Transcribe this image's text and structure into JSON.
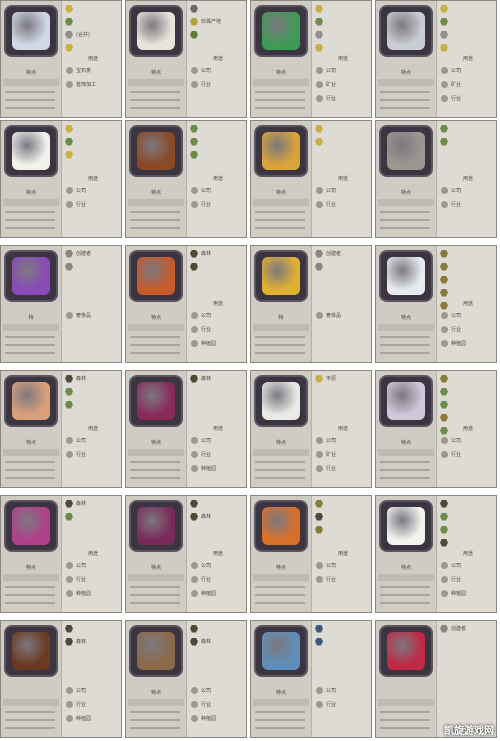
{
  "cards": [
    {
      "id": "diamond",
      "rows": [
        "",
        "",
        "(合并)",
        ""
      ],
      "section": "特点",
      "usage": "用途",
      "bottom": [
        "宝石类",
        "首饰加工"
      ],
      "icon_color": "#cfd8e6",
      "hex": [
        "#c9b043",
        "#6d8c4b",
        "#8f8f8f"
      ]
    },
    {
      "id": "pearl",
      "rows": [
        "",
        "珍珠产地",
        ""
      ],
      "section": "特点",
      "usage": "用途",
      "bottom": [
        "公司",
        "行业"
      ],
      "icon_color": "#e8e4da",
      "hex": [
        "#6a6a6a",
        "#b0a23e",
        "#5d7e3b"
      ]
    },
    {
      "id": "jade-dragon",
      "rows": [
        "",
        "",
        "",
        ""
      ],
      "section": "特点",
      "usage": "用途",
      "bottom": [
        "公司",
        "矿业",
        "行业"
      ],
      "icon_color": "#3f9a55",
      "hex": [
        "#c9b043",
        "#6d8c4b",
        "#8f8f8f"
      ]
    },
    {
      "id": "silver-pitcher",
      "rows": [
        "",
        "",
        "",
        ""
      ],
      "section": "特点",
      "usage": "用途",
      "bottom": [
        "公司",
        "矿业",
        "行业"
      ],
      "icon_color": "#c9ccd2",
      "hex": [
        "#c9b043",
        "#6d8c4b",
        "#8f8f8f"
      ]
    },
    {
      "id": "salt",
      "rows": [
        "",
        "",
        ""
      ],
      "section": "特点",
      "usage": "用途",
      "bottom": [
        "公司",
        "行业"
      ],
      "icon_color": "#f1f1ee",
      "hex": [
        "#c9b043",
        "#6d8c4b",
        "#c9b043"
      ]
    },
    {
      "id": "pipe",
      "rows": [
        "",
        "",
        ""
      ],
      "section": "特点",
      "usage": "用途",
      "bottom": [
        "公司",
        "行业"
      ],
      "icon_color": "#8b4a25",
      "hex": [
        "#6d8c4b",
        "#6d8c4b",
        "#6d8c4b"
      ]
    },
    {
      "id": "incense",
      "rows": [
        "",
        ""
      ],
      "section": "特点",
      "usage": "用途",
      "bottom": [
        "公司",
        "行业"
      ],
      "icon_color": "#d9a23a",
      "hex": [
        "#c9b043",
        "#c9b043"
      ]
    },
    {
      "id": "ivory",
      "rows": [
        "",
        ""
      ],
      "section": "特点",
      "usage": "用途",
      "bottom": [
        "公司",
        "行业"
      ],
      "icon_color": "#9a9690",
      "hex": [
        "#6d8c4b",
        "#6d8c4b"
      ]
    },
    {
      "id": "perfume",
      "rows": [
        "创建者",
        ""
      ],
      "section": "特",
      "usage": "",
      "bottom": [
        "奢侈品"
      ],
      "icon_color": "#8a4bb8",
      "hex": []
    },
    {
      "id": "spices",
      "rows": [
        "森林",
        ""
      ],
      "section": "特点",
      "usage": "用途",
      "bottom": [
        "公司",
        "行业",
        "种植园"
      ],
      "icon_color": "#c65a2a",
      "hex": [
        "#4d4a3a",
        "#4d4a3a"
      ]
    },
    {
      "id": "toy-rings",
      "rows": [
        "创建者",
        ""
      ],
      "section": "特",
      "usage": "",
      "bottom": [
        "奢侈品"
      ],
      "icon_color": "#e0b030",
      "hex": []
    },
    {
      "id": "sugar",
      "rows": [
        "",
        "",
        "",
        "",
        ""
      ],
      "section": "特点",
      "usage": "用途",
      "bottom": [
        "公司",
        "行业",
        "种植园"
      ],
      "icon_color": "#e6ebf0",
      "hex": [
        "#8a7a3a",
        "#8a7a3a",
        "#8a7a3a"
      ]
    },
    {
      "id": "meat",
      "rows": [
        "森林",
        "",
        ""
      ],
      "section": "特点",
      "usage": "用途",
      "bottom": [
        "公司",
        "行业"
      ],
      "icon_color": "#d9a07a",
      "hex": [
        "#4d4a3a",
        "#6d8c4b",
        "#6d8c4b"
      ]
    },
    {
      "id": "silk",
      "rows": [
        "森林"
      ],
      "section": "特点",
      "usage": "用途",
      "bottom": [
        "公司",
        "行业",
        "种植园"
      ],
      "icon_color": "#8a2a5a",
      "hex": [
        "#4d4a3a"
      ]
    },
    {
      "id": "porcelain",
      "rows": [
        "平原"
      ],
      "section": "特点",
      "usage": "用途",
      "bottom": [
        "公司",
        "矿业",
        "行业"
      ],
      "icon_color": "#e9e9e6",
      "hex": [
        "#c9b043"
      ]
    },
    {
      "id": "crystal",
      "rows": [
        "",
        "",
        "",
        "",
        ""
      ],
      "section": "特点",
      "usage": "用途",
      "bottom": [
        "公司",
        "行业"
      ],
      "icon_color": "#cfc7da",
      "hex": [
        "#8a7a3a",
        "#6d8c4b",
        "#6d8c4b"
      ]
    },
    {
      "id": "dyes",
      "rows": [
        "森林",
        ""
      ],
      "section": "特点",
      "usage": "用途",
      "bottom": [
        "公司",
        "行业",
        "种植园"
      ],
      "icon_color": "#b0408a",
      "hex": [
        "#4d4a3a",
        "#6d8c4b"
      ]
    },
    {
      "id": "wine",
      "rows": [
        "",
        "森林"
      ],
      "section": "特点",
      "usage": "用途",
      "bottom": [
        "公司",
        "行业",
        "种植园"
      ],
      "icon_color": "#7a2a5a",
      "hex": [
        "#4d4a3a",
        "#4d4a3a"
      ]
    },
    {
      "id": "fur",
      "rows": [
        "",
        "",
        ""
      ],
      "section": "特点",
      "usage": "用途",
      "bottom": [
        "公司",
        "行业"
      ],
      "icon_color": "#d9702a",
      "hex": [
        "#8a7a3a",
        "#4d4a3a"
      ]
    },
    {
      "id": "cotton",
      "rows": [
        "",
        "",
        "",
        ""
      ],
      "section": "特点",
      "usage": "用途",
      "bottom": [
        "公司",
        "行业",
        "种植园"
      ],
      "icon_color": "#f2f2ee",
      "hex": [
        "#4d4a3a",
        "#6d8c4b",
        "#6d8c4b"
      ]
    },
    {
      "id": "chocolate",
      "rows": [
        "",
        "森林"
      ],
      "section": "",
      "usage": "",
      "bottom": [
        "公司",
        "行业",
        "种植园"
      ],
      "icon_color": "#6b3a22",
      "hex": [
        "#4d4a3a"
      ]
    },
    {
      "id": "coffee",
      "rows": [
        "",
        "森林"
      ],
      "section": "特点",
      "usage": "",
      "bottom": [
        "公司",
        "行业",
        "种植园"
      ],
      "icon_color": "#8a6a4a",
      "hex": [
        "#4d4a3a"
      ]
    },
    {
      "id": "whale",
      "rows": [
        "",
        ""
      ],
      "section": "特点",
      "usage": "",
      "bottom": [
        "公司",
        "行业"
      ],
      "icon_color": "#5f8fb8",
      "hex": [
        "#3a5a7a"
      ]
    },
    {
      "id": "cosmetics",
      "rows": [
        "创建者"
      ],
      "section": "",
      "usage": "",
      "bottom": [],
      "icon_color": "#c02a45",
      "hex": []
    }
  ],
  "watermark": "凯旋游戏网"
}
